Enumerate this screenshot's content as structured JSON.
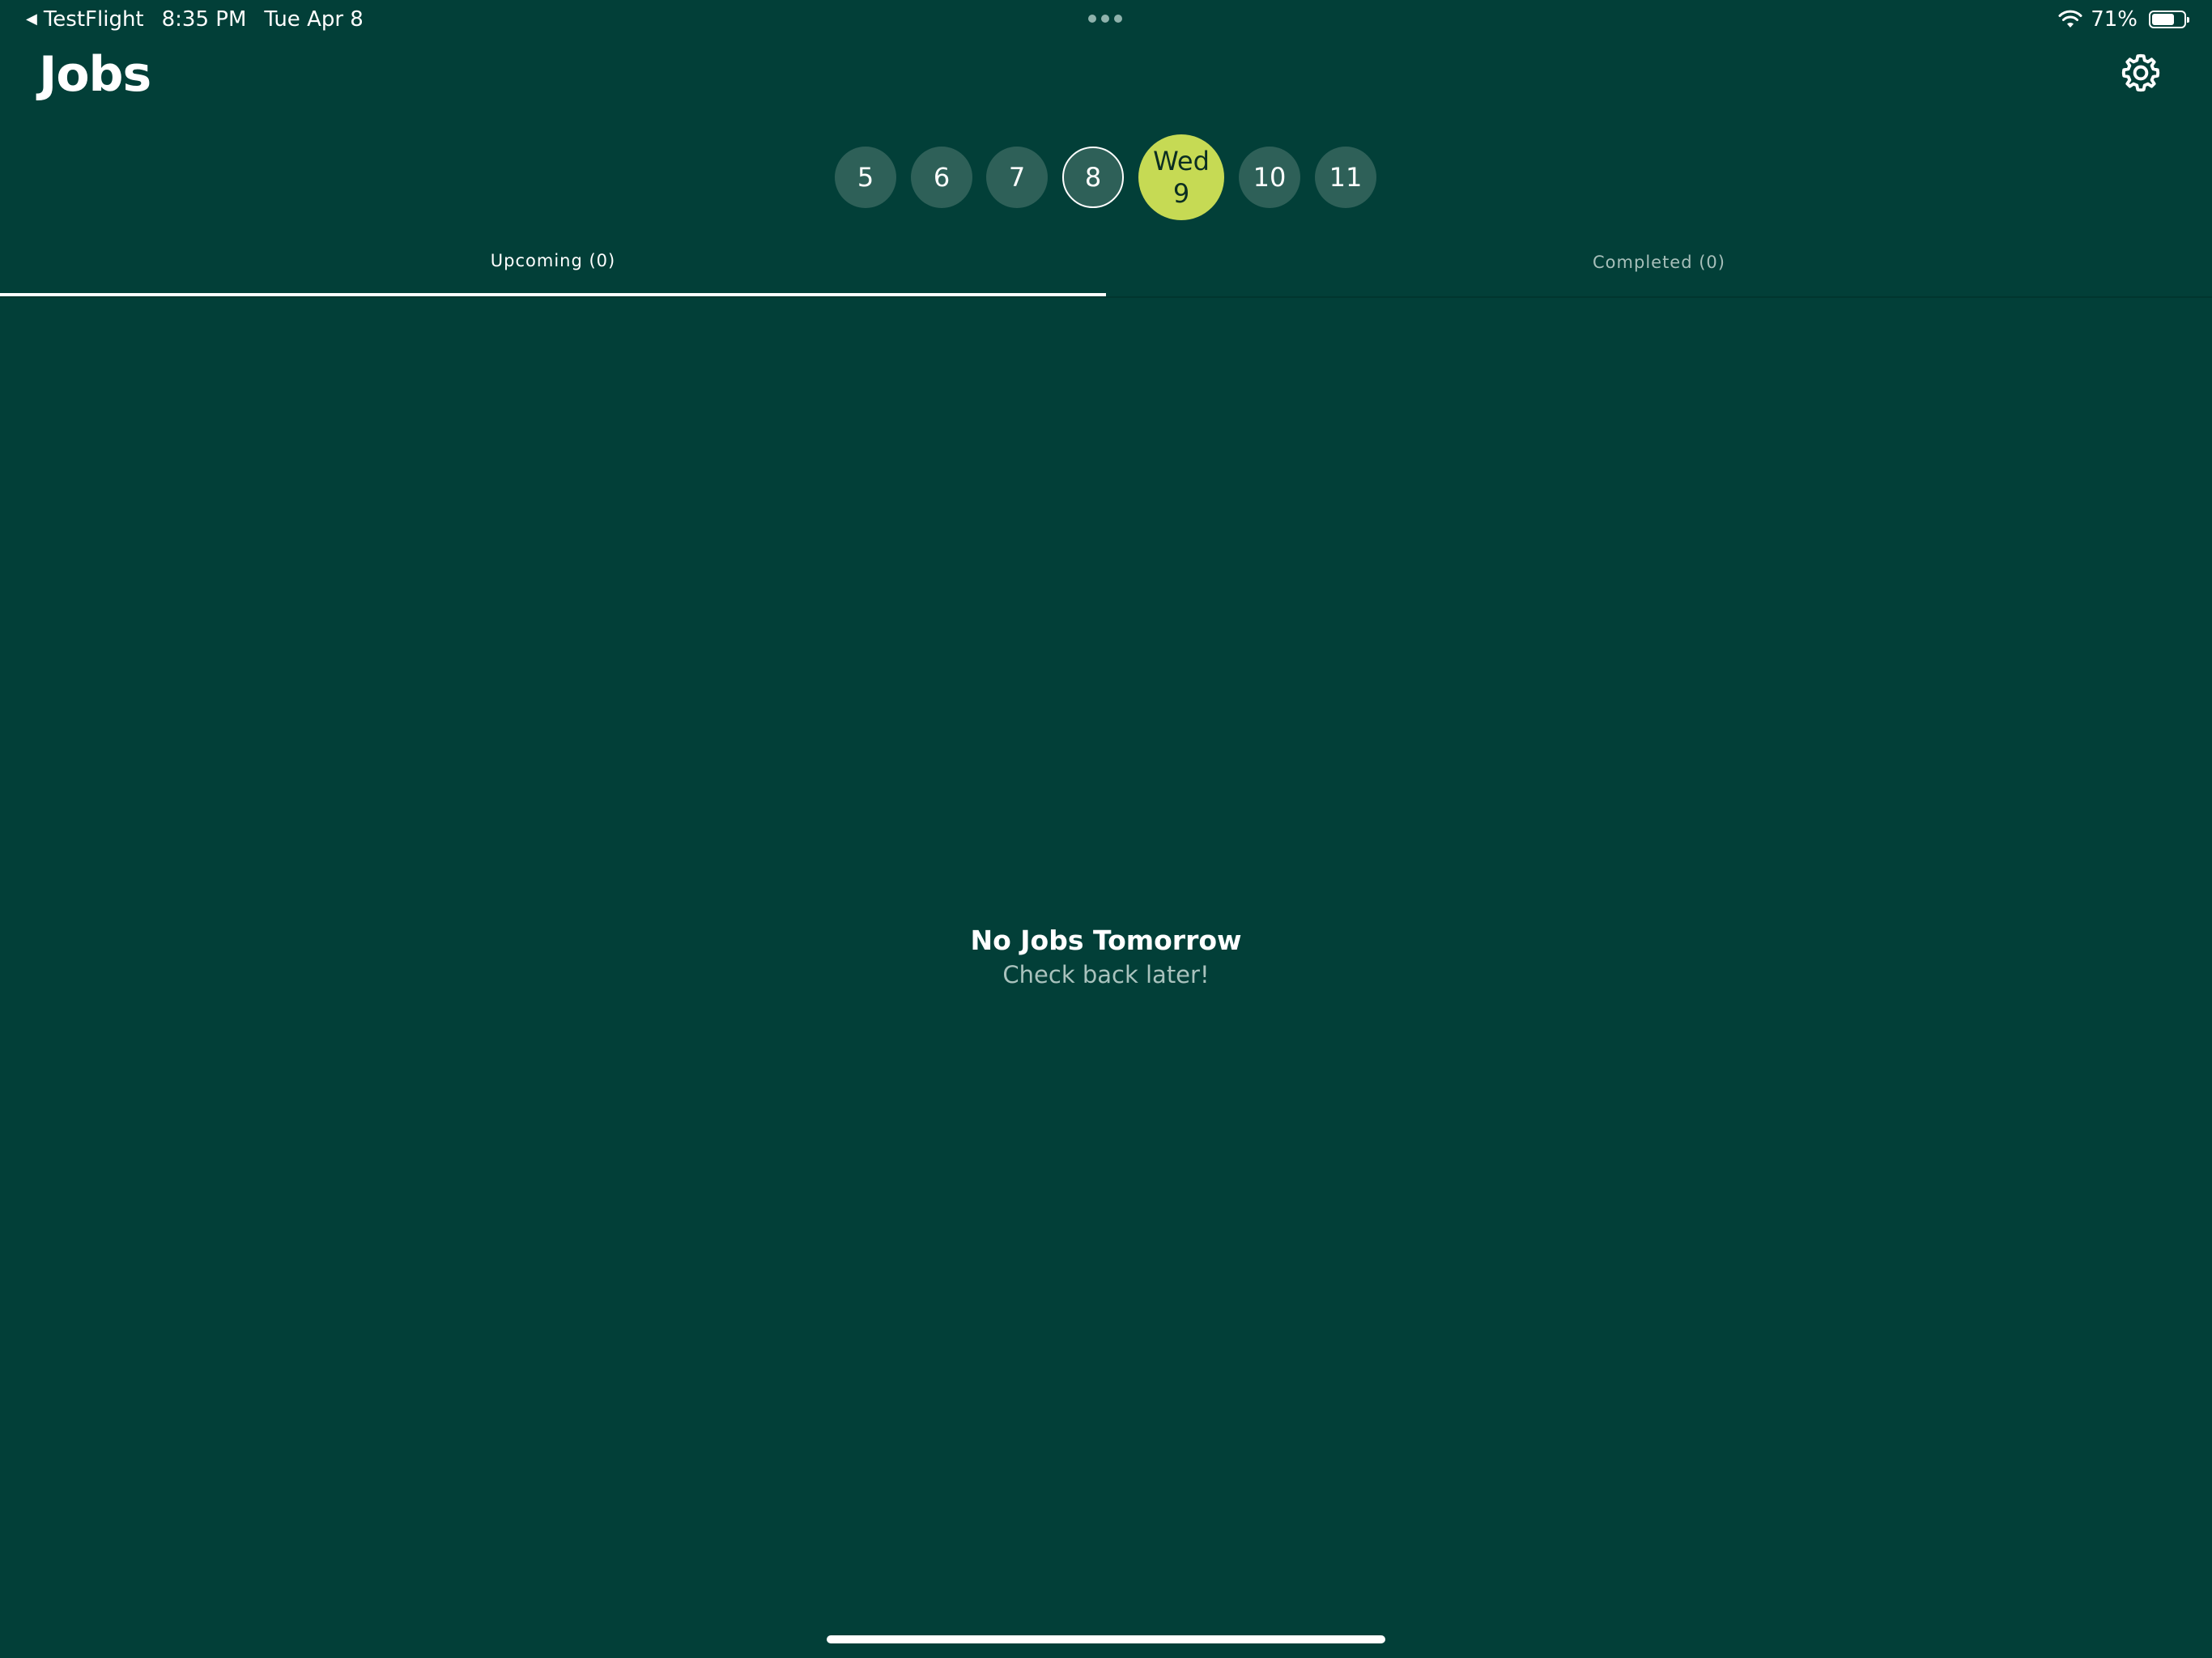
{
  "status_bar": {
    "back_app": "TestFlight",
    "time": "8:35 PM",
    "date": "Tue Apr 8",
    "battery_percent": "71%",
    "battery_level": 0.71
  },
  "header": {
    "title": "Jobs"
  },
  "date_strip": {
    "days": [
      {
        "label": "5"
      },
      {
        "label": "6"
      },
      {
        "label": "7"
      },
      {
        "label": "8",
        "state": "today"
      },
      {
        "weekday": "Wed",
        "label": "9",
        "state": "selected"
      },
      {
        "label": "10"
      },
      {
        "label": "11"
      }
    ]
  },
  "tabs": {
    "upcoming": "Upcoming (0)",
    "completed": "Completed (0)",
    "active": "upcoming"
  },
  "empty_state": {
    "title": "No Jobs Tomorrow",
    "subtitle": "Check back later!"
  },
  "colors": {
    "background": "#023f38",
    "day_chip": "#2e6058",
    "selected_day": "#c6da54"
  }
}
